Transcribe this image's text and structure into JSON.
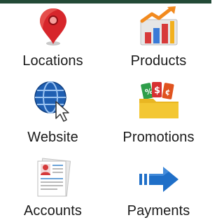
{
  "menu": {
    "items": [
      {
        "label": "Locations",
        "icon": "map-pin-icon"
      },
      {
        "label": "Products",
        "icon": "bar-chart-growth-icon"
      },
      {
        "label": "Website",
        "icon": "globe-cursor-icon"
      },
      {
        "label": "Promotions",
        "icon": "price-tags-folder-icon"
      },
      {
        "label": "Accounts",
        "icon": "profile-document-icon"
      },
      {
        "label": "Payments",
        "icon": "arrow-right-icon"
      }
    ]
  },
  "colors": {
    "header_bar": "#234a37",
    "pin_red": "#d7262b",
    "globe_blue": "#1f5fb2",
    "arrow_blue": "#1f6fc8",
    "folder_yellow": "#f3c733",
    "chart_orange": "#f28a1e"
  }
}
